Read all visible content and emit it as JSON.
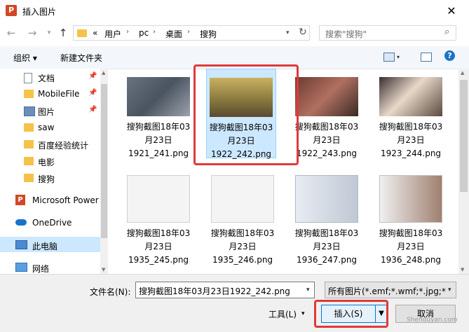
{
  "window": {
    "title": "插入图片",
    "app_icon": "P"
  },
  "address": {
    "prefix": "«",
    "crumbs": [
      "用户",
      "pc",
      "桌面",
      "搜狗"
    ],
    "search_placeholder": "搜索\"搜狗\""
  },
  "toolbar": {
    "organize": "组织 ▾",
    "new_folder": "新建文件夹"
  },
  "sidebar": {
    "items": [
      {
        "label": "文档",
        "icon": "document-icon",
        "pinned": true
      },
      {
        "label": "MobileFile",
        "icon": "folder-icon",
        "pinned": true
      },
      {
        "label": "图片",
        "icon": "pictures-icon",
        "pinned": true
      },
      {
        "label": "saw",
        "icon": "folder-icon",
        "pinned": false
      },
      {
        "label": "百度经验统计",
        "icon": "folder-icon",
        "pinned": false
      },
      {
        "label": "电影",
        "icon": "folder-icon",
        "pinned": false
      },
      {
        "label": "搜狗",
        "icon": "folder-icon",
        "pinned": false
      },
      {
        "label": "Microsoft Power",
        "icon": "powerpoint-icon",
        "pinned": false
      },
      {
        "label": "OneDrive",
        "icon": "onedrive-icon",
        "pinned": false
      },
      {
        "label": "此电脑",
        "icon": "computer-icon",
        "pinned": false
      },
      {
        "label": "网络",
        "icon": "network-icon",
        "pinned": false
      }
    ]
  },
  "files": [
    {
      "label": "搜狗截图18年03\n月23日\n1921_241.png"
    },
    {
      "label": "搜狗截图18年03\n月23日\n1922_242.png",
      "selected": true
    },
    {
      "label": "搜狗截图18年03\n月23日\n1922_243.png"
    },
    {
      "label": "搜狗截图18年03\n月23日\n1923_244.png"
    },
    {
      "label": "搜狗截图18年03\n月23日\n1935_245.png"
    },
    {
      "label": "搜狗截图18年03\n月23日\n1935_246.png"
    },
    {
      "label": "搜狗截图18年03\n月23日\n1936_247.png"
    },
    {
      "label": "搜狗截图18年03\n月23日\n1936_248.png"
    }
  ],
  "bottom": {
    "filename_label": "文件名(N):",
    "filename_value": "搜狗截图18年03月23日1922_242.png",
    "filter_value": "所有图片(*.emf;*.wmf;*.jpg;*.jp",
    "tools_label": "工具(L)",
    "insert_label": "插入(S)",
    "cancel_label": "取消"
  },
  "watermark": "Shenduyan.com",
  "colors": {
    "accent_select": "#cce8ff",
    "highlight_red": "#e03a3a"
  }
}
